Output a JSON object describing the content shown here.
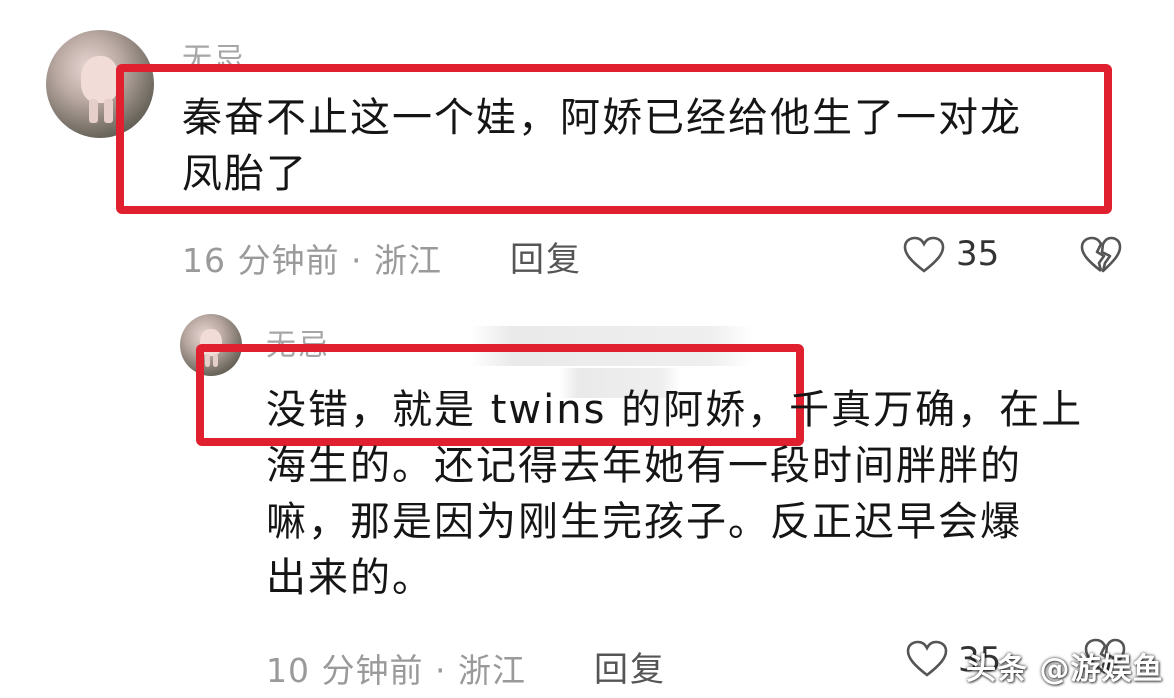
{
  "comments": [
    {
      "username": "无忌",
      "text_line1": "秦奋不止这一个娃，阿娇已经给他生了一对龙",
      "text_line2": "凤胎了",
      "meta": "16 分钟前 · 浙江",
      "reply_label": "回复",
      "likes": "35"
    },
    {
      "username": "无忌",
      "text_line1": "没错，就是 twins 的阿娇，千真万确，在上",
      "text_line2": "海生的。还记得去年她有一段时间胖胖的",
      "text_line3": "嘛，那是因为刚生完孩子。反正迟早会爆",
      "text_line4": "出来的。",
      "meta": "10 分钟前 · 浙江",
      "reply_label": "回复",
      "likes": "35"
    }
  ],
  "watermark": "头条 @游娱鱼",
  "colors": {
    "highlight_box": "#e0202e",
    "meta_text": "#9a9a9a"
  },
  "icons": {
    "like": "heart-icon",
    "dislike": "broken-heart-icon",
    "avatar": "pig-avatar"
  }
}
